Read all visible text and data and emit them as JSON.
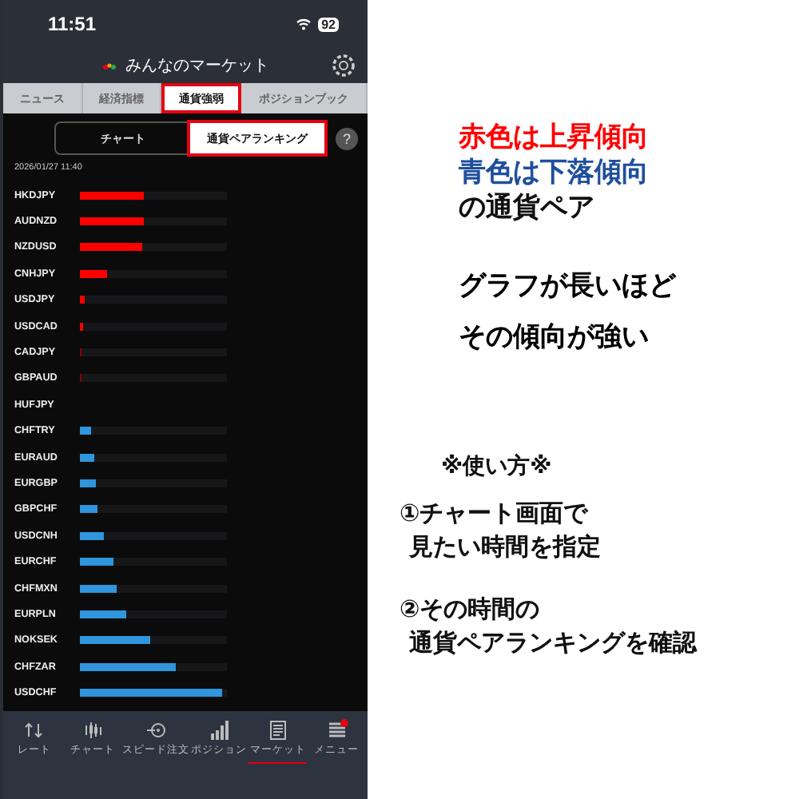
{
  "status_bar": {
    "time": "11:51",
    "battery": "92"
  },
  "header": {
    "title": "みんなのマーケット"
  },
  "tabs": [
    {
      "label": "ニュース",
      "selected": false,
      "highlighted": false
    },
    {
      "label": "経済指標",
      "selected": false,
      "highlighted": false
    },
    {
      "label": "通貨強弱",
      "selected": true,
      "highlighted": true
    },
    {
      "label": "ポジションブック",
      "selected": false,
      "highlighted": false
    }
  ],
  "segments": [
    {
      "label": "チャート",
      "selected": false,
      "highlighted": false
    },
    {
      "label": "通貨ペアランキング",
      "selected": true,
      "highlighted": true
    }
  ],
  "help": "?",
  "timestamp": "2026/01/27 11:40",
  "ranking": [
    {
      "pair": "HKDJPY",
      "level": 0.44,
      "color": "#ff0000"
    },
    {
      "pair": "AUDNZD",
      "level": 0.43,
      "color": "#ff0000"
    },
    {
      "pair": "NZDUSD",
      "level": 0.42,
      "color": "#ff0000"
    },
    {
      "pair": "CNHJPY",
      "level": 0.19,
      "color": "#ff0000"
    },
    {
      "pair": "USDJPY",
      "level": 0.03,
      "color": "#ff0000"
    },
    {
      "pair": "USDCAD",
      "level": 0.02,
      "color": "#ff0000"
    },
    {
      "pair": "CADJPY",
      "level": 0.01,
      "color": "#8b0000"
    },
    {
      "pair": "GBPAUD",
      "level": 0.01,
      "color": "#8b0000"
    },
    {
      "pair": "HUFJPY"
    },
    {
      "pair": "CHFTRY",
      "level": 0.08,
      "color": "#2f95dc"
    },
    {
      "pair": "EURAUD",
      "level": 0.1,
      "color": "#2f95dc"
    },
    {
      "pair": "EURGBP",
      "level": 0.11,
      "color": "#2f95dc"
    },
    {
      "pair": "GBPCHF",
      "level": 0.12,
      "color": "#2f95dc"
    },
    {
      "pair": "USDCNH",
      "level": 0.16,
      "color": "#2f95dc"
    },
    {
      "pair": "EURCHF",
      "level": 0.23,
      "color": "#2f95dc"
    },
    {
      "pair": "CHFMXN",
      "level": 0.25,
      "color": "#2f95dc"
    },
    {
      "pair": "EURPLN",
      "level": 0.31,
      "color": "#2f95dc"
    },
    {
      "pair": "NOKSEK",
      "level": 0.48,
      "color": "#2f95dc"
    },
    {
      "pair": "CHFZAR",
      "level": 0.65,
      "color": "#2f95dc"
    },
    {
      "pair": "USDCHF",
      "level": 0.97,
      "color": "#2f95dc"
    }
  ],
  "nav": [
    {
      "label": "レート",
      "kind": "rate",
      "selected": false,
      "badge": false
    },
    {
      "label": "チャート",
      "kind": "chart",
      "selected": false,
      "badge": false
    },
    {
      "label": "スピード注文",
      "kind": "speed",
      "selected": false,
      "badge": false
    },
    {
      "label": "ポジション",
      "kind": "position",
      "selected": false,
      "badge": false
    },
    {
      "label": "マーケット",
      "kind": "market",
      "selected": true,
      "badge": false
    },
    {
      "label": "メニュー",
      "kind": "menu",
      "selected": false,
      "badge": true
    }
  ],
  "notes": {
    "legend": [
      {
        "text": "赤色は上昇傾向",
        "color": "#ff0000"
      },
      {
        "text": "青色は下落傾向",
        "color": "#1f4e9c"
      },
      {
        "text": "の通貨ペア",
        "color": "#111111"
      }
    ],
    "meaning": [
      "グラフが長いほど",
      "その傾向が強い"
    ],
    "howto_title": "※使い方※",
    "steps": [
      [
        "①チャート画面で",
        "見たい時間を指定"
      ],
      [
        "②その時間の",
        "通貨ペアランキングを確認"
      ]
    ]
  }
}
